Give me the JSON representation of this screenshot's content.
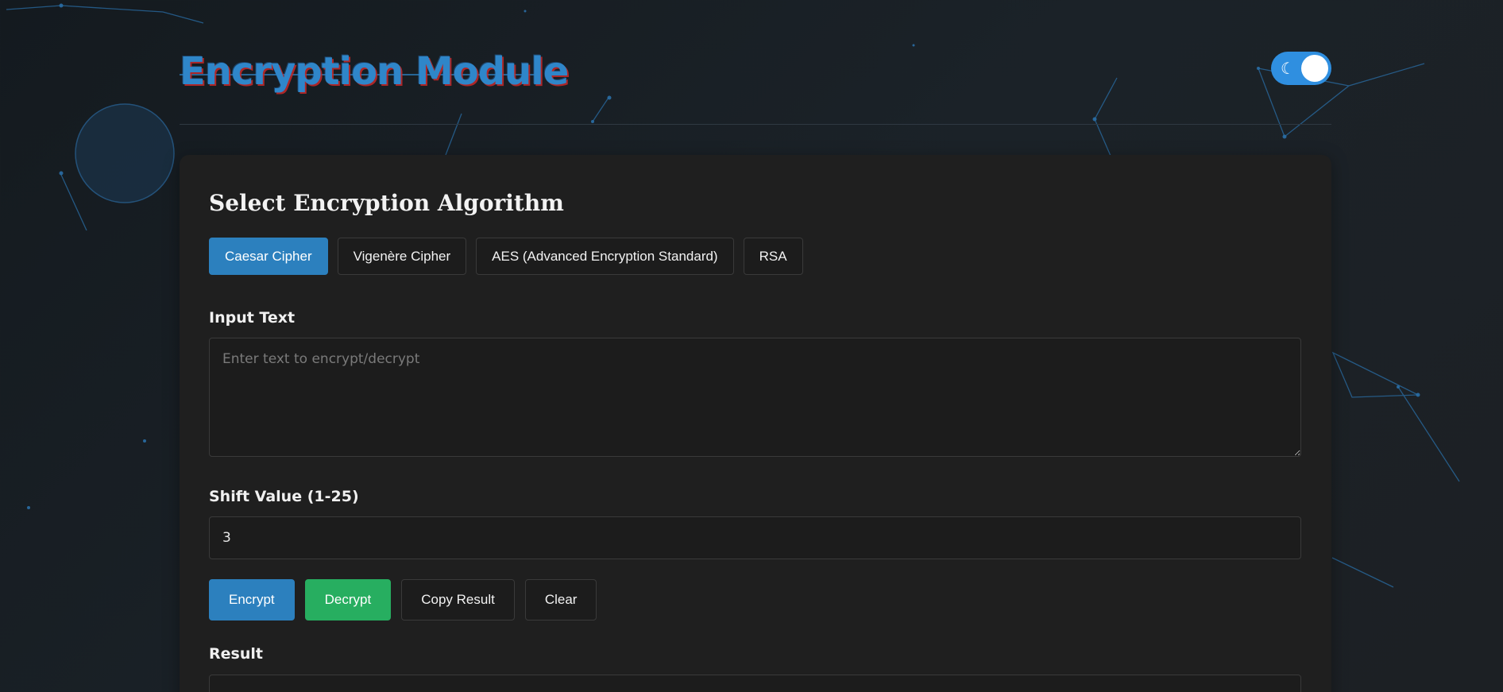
{
  "header": {
    "title": "Encryption Module",
    "theme_toggle_icon": "moon-icon"
  },
  "algorithm_section": {
    "title": "Select Encryption Algorithm",
    "options": [
      {
        "label": "Caesar Cipher",
        "active": true
      },
      {
        "label": "Vigenère Cipher",
        "active": false
      },
      {
        "label": "AES (Advanced Encryption Standard)",
        "active": false
      },
      {
        "label": "RSA",
        "active": false
      }
    ]
  },
  "input": {
    "label": "Input Text",
    "placeholder": "Enter text to encrypt/decrypt",
    "value": ""
  },
  "shift": {
    "label": "Shift Value (1-25)",
    "value": "3"
  },
  "actions": {
    "encrypt": "Encrypt",
    "decrypt": "Decrypt",
    "copy": "Copy Result",
    "clear": "Clear"
  },
  "result": {
    "label": "Result",
    "value": ""
  },
  "colors": {
    "accent": "#2c80be",
    "success": "#27ae60",
    "title": "#2f86c9",
    "card": "#1f1f1f"
  }
}
